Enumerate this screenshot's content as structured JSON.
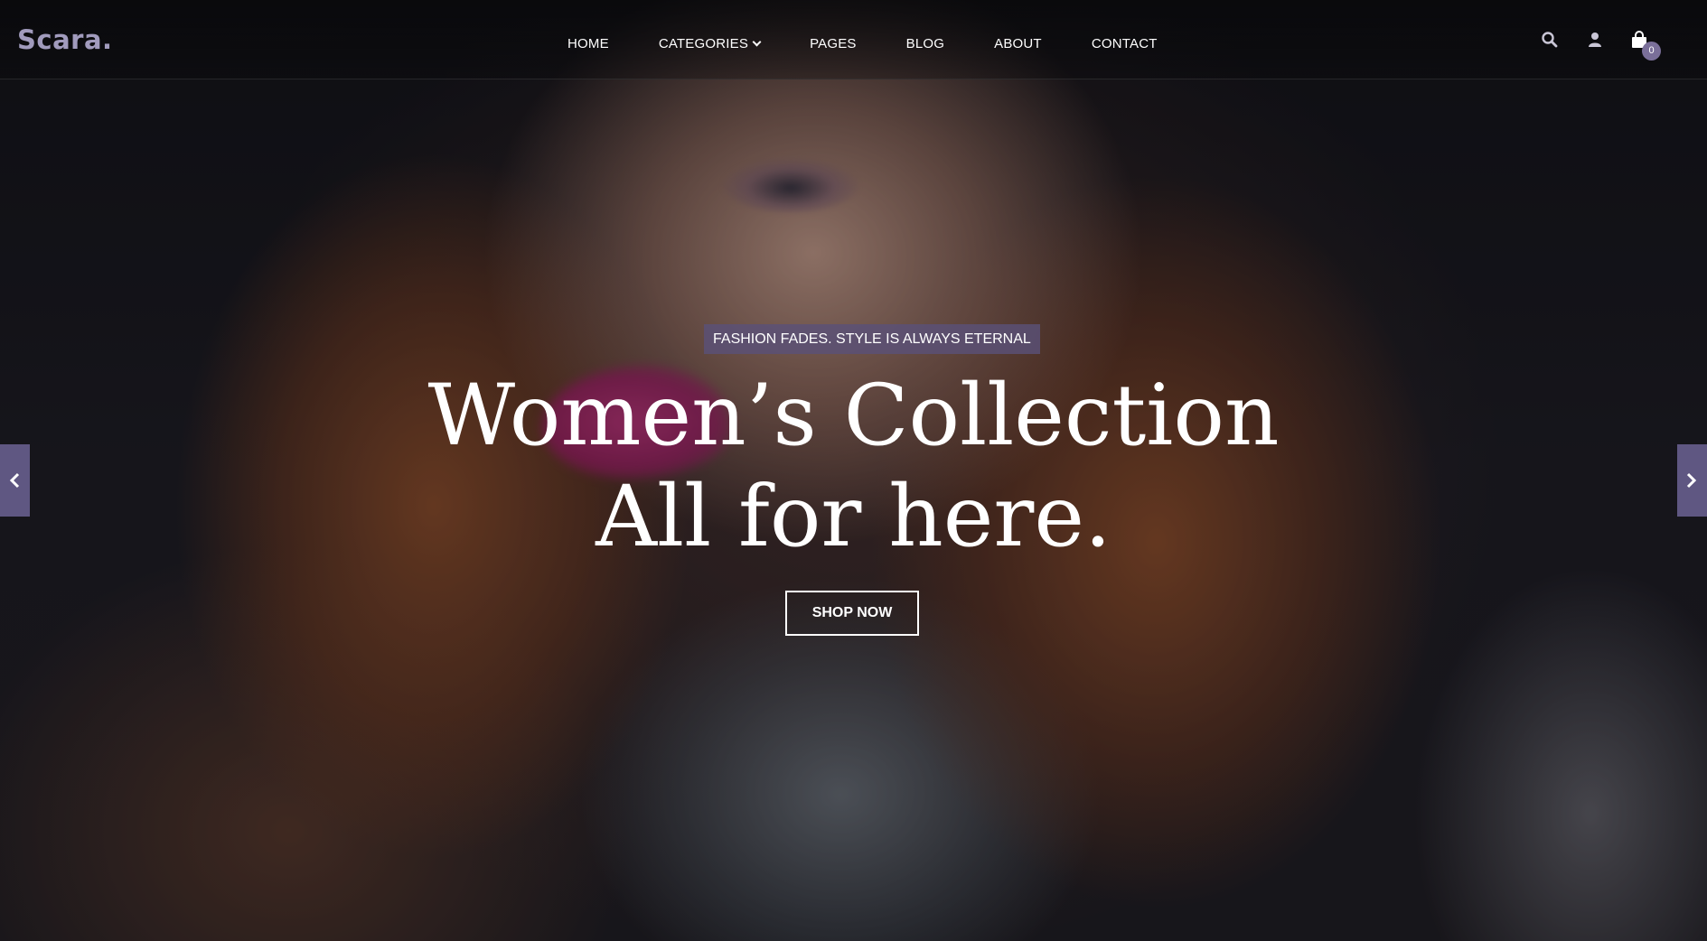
{
  "header": {
    "logo": "Scara.",
    "nav": [
      "HOME",
      "CATEGORIES",
      "PAGES",
      "BLOG",
      "ABOUT",
      "CONTACT"
    ],
    "cart_count": "0",
    "icons": [
      "search-icon",
      "user-icon",
      "shopping-bag-icon"
    ]
  },
  "hero": {
    "tagline": "FASHION FADES. STYLE IS ALWAYS ETERNAL",
    "headline_line1": "Women’s Collection",
    "headline_line2": "All for here.",
    "cta_label": "SHOP NOW",
    "prev_icon": "chevron-left-icon",
    "next_icon": "chevron-right-icon"
  },
  "colors": {
    "logo": "#a19bbd",
    "accent": "#7a6f99",
    "tagline_bg": "#5a5078",
    "text": "#ffffff"
  }
}
